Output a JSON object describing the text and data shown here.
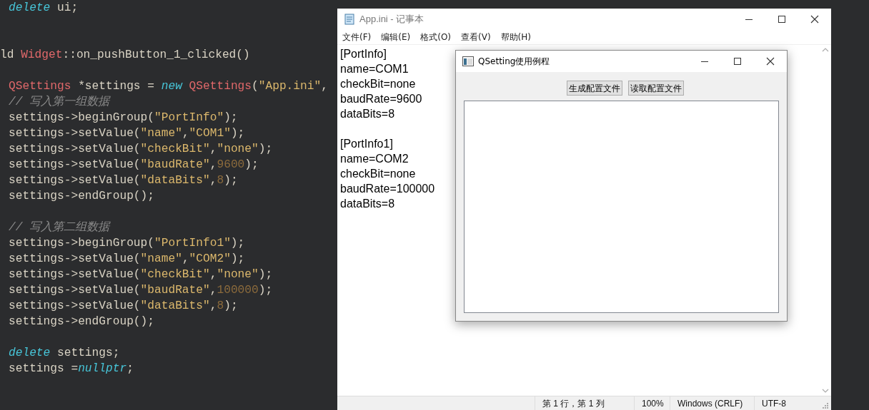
{
  "editor": {
    "lines": [
      {
        "kind": "code",
        "tokens": [
          {
            "kind": "keyword",
            "text": "delete"
          },
          {
            "kind": "plain",
            "text": " ui;"
          }
        ]
      },
      {
        "kind": "blank"
      },
      {
        "kind": "blank"
      },
      {
        "kind": "signature",
        "tokens": [
          {
            "kind": "plain",
            "text": "ld "
          },
          {
            "kind": "type",
            "text": "Widget"
          },
          {
            "kind": "plain",
            "text": "::on_pushButton_1_clicked()"
          }
        ]
      },
      {
        "kind": "blank"
      },
      {
        "kind": "code",
        "tokens": [
          {
            "kind": "type",
            "text": "QSettings"
          },
          {
            "kind": "plain",
            "text": " *settings = "
          },
          {
            "kind": "keyword",
            "text": "new "
          },
          {
            "kind": "type",
            "text": "QSettings"
          },
          {
            "kind": "plain",
            "text": "("
          },
          {
            "kind": "string",
            "text": "\"App.ini\""
          },
          {
            "kind": "plain",
            "text": ","
          }
        ]
      },
      {
        "kind": "code",
        "tokens": [
          {
            "kind": "comment",
            "text": "// 写入第一组数据"
          }
        ]
      },
      {
        "kind": "code",
        "tokens": [
          {
            "kind": "plain",
            "text": "settings->beginGroup("
          },
          {
            "kind": "string",
            "text": "\"PortInfo\""
          },
          {
            "kind": "plain",
            "text": ");"
          }
        ]
      },
      {
        "kind": "code",
        "tokens": [
          {
            "kind": "plain",
            "text": "settings->setValue("
          },
          {
            "kind": "string",
            "text": "\"name\""
          },
          {
            "kind": "plain",
            "text": ","
          },
          {
            "kind": "string",
            "text": "\"COM1\""
          },
          {
            "kind": "plain",
            "text": ");"
          }
        ]
      },
      {
        "kind": "code",
        "tokens": [
          {
            "kind": "plain",
            "text": "settings->setValue("
          },
          {
            "kind": "string",
            "text": "\"checkBit\""
          },
          {
            "kind": "plain",
            "text": ","
          },
          {
            "kind": "string",
            "text": "\"none\""
          },
          {
            "kind": "plain",
            "text": ");"
          }
        ]
      },
      {
        "kind": "code",
        "tokens": [
          {
            "kind": "plain",
            "text": "settings->setValue("
          },
          {
            "kind": "string",
            "text": "\"baudRate\""
          },
          {
            "kind": "plain",
            "text": ","
          },
          {
            "kind": "number",
            "text": "9600"
          },
          {
            "kind": "plain",
            "text": ");"
          }
        ]
      },
      {
        "kind": "code",
        "tokens": [
          {
            "kind": "plain",
            "text": "settings->setValue("
          },
          {
            "kind": "string",
            "text": "\"dataBits\""
          },
          {
            "kind": "plain",
            "text": ","
          },
          {
            "kind": "number",
            "text": "8"
          },
          {
            "kind": "plain",
            "text": ");"
          }
        ]
      },
      {
        "kind": "code",
        "tokens": [
          {
            "kind": "plain",
            "text": "settings->endGroup();"
          }
        ]
      },
      {
        "kind": "blank"
      },
      {
        "kind": "code",
        "tokens": [
          {
            "kind": "comment",
            "text": "// 写入第二组数据"
          }
        ]
      },
      {
        "kind": "code",
        "tokens": [
          {
            "kind": "plain",
            "text": "settings->beginGroup("
          },
          {
            "kind": "string",
            "text": "\"PortInfo1\""
          },
          {
            "kind": "plain",
            "text": ");"
          }
        ]
      },
      {
        "kind": "code",
        "tokens": [
          {
            "kind": "plain",
            "text": "settings->setValue("
          },
          {
            "kind": "string",
            "text": "\"name\""
          },
          {
            "kind": "plain",
            "text": ","
          },
          {
            "kind": "string",
            "text": "\"COM2\""
          },
          {
            "kind": "plain",
            "text": ");"
          }
        ]
      },
      {
        "kind": "code",
        "tokens": [
          {
            "kind": "plain",
            "text": "settings->setValue("
          },
          {
            "kind": "string",
            "text": "\"checkBit\""
          },
          {
            "kind": "plain",
            "text": ","
          },
          {
            "kind": "string",
            "text": "\"none\""
          },
          {
            "kind": "plain",
            "text": ");"
          }
        ]
      },
      {
        "kind": "code",
        "tokens": [
          {
            "kind": "plain",
            "text": "settings->setValue("
          },
          {
            "kind": "string",
            "text": "\"baudRate\""
          },
          {
            "kind": "plain",
            "text": ","
          },
          {
            "kind": "number",
            "text": "100000"
          },
          {
            "kind": "plain",
            "text": ");"
          }
        ]
      },
      {
        "kind": "code",
        "tokens": [
          {
            "kind": "plain",
            "text": "settings->setValue("
          },
          {
            "kind": "string",
            "text": "\"dataBits\""
          },
          {
            "kind": "plain",
            "text": ","
          },
          {
            "kind": "number",
            "text": "8"
          },
          {
            "kind": "plain",
            "text": ");"
          }
        ]
      },
      {
        "kind": "code",
        "tokens": [
          {
            "kind": "plain",
            "text": "settings->endGroup();"
          }
        ]
      },
      {
        "kind": "blank"
      },
      {
        "kind": "code",
        "tokens": [
          {
            "kind": "keyword",
            "text": "delete"
          },
          {
            "kind": "plain",
            "text": " settings;"
          }
        ]
      },
      {
        "kind": "code",
        "tokens": [
          {
            "kind": "plain",
            "text": "settings ="
          },
          {
            "kind": "keyword",
            "text": "nullptr"
          },
          {
            "kind": "plain",
            "text": ";"
          }
        ]
      }
    ]
  },
  "notepad": {
    "title": "App.ini - 记事本",
    "menu": [
      "文件(F)",
      "编辑(E)",
      "格式(O)",
      "查看(V)",
      "帮助(H)"
    ],
    "paragraphs": [
      [
        "[PortInfo]",
        "name=COM1",
        "checkBit=none",
        "baudRate=9600",
        "dataBits=8"
      ],
      [
        "[PortInfo1]",
        "name=COM2",
        "checkBit=none",
        "baudRate=100000",
        "dataBits=8"
      ]
    ],
    "status_bar": [
      "第 1 行，第 1 列",
      "100%",
      "Windows (CRLF)",
      "UTF-8"
    ]
  },
  "dialog": {
    "title": "QSetting使用例程",
    "buttons": [
      "生成配置文件",
      "读取配置文件"
    ]
  }
}
